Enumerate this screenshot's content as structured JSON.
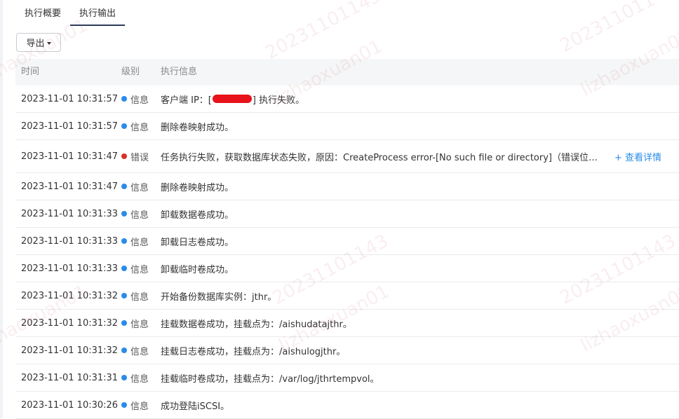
{
  "tabs": [
    {
      "label": "执行概要",
      "active": false
    },
    {
      "label": "执行输出",
      "active": true
    }
  ],
  "toolbar": {
    "export_label": "导出"
  },
  "table": {
    "headers": {
      "time": "时间",
      "level": "级别",
      "message": "执行信息"
    },
    "rows": [
      {
        "time": "2023-11-01 10:31:57",
        "level": "信息",
        "status": "info",
        "msg_before": "客户端 IP：[",
        "msg_after": "] 执行失败。"
      },
      {
        "time": "2023-11-01 10:31:57",
        "level": "信息",
        "status": "info",
        "message": "删除卷映射成功。"
      },
      {
        "time": "2023-11-01 10:31:47",
        "level": "错误",
        "status": "error",
        "message": "任务执行失败，获取数据库状态失败，原因：CreateProcess error-[No such file or directory]（错误位置：n…",
        "detail_link": "+ 查看详情"
      },
      {
        "time": "2023-11-01 10:31:47",
        "level": "信息",
        "status": "info",
        "message": "删除卷映射成功。"
      },
      {
        "time": "2023-11-01 10:31:33",
        "level": "信息",
        "status": "info",
        "message": "卸载数据卷成功。"
      },
      {
        "time": "2023-11-01 10:31:33",
        "level": "信息",
        "status": "info",
        "message": "卸载日志卷成功。"
      },
      {
        "time": "2023-11-01 10:31:33",
        "level": "信息",
        "status": "info",
        "message": "卸载临时卷成功。"
      },
      {
        "time": "2023-11-01 10:31:32",
        "level": "信息",
        "status": "info",
        "message": "开始备份数据库实例：jthr。"
      },
      {
        "time": "2023-11-01 10:31:32",
        "level": "信息",
        "status": "info",
        "message": "挂载数据卷成功，挂载点为：/aishudatajthr。"
      },
      {
        "time": "2023-11-01 10:31:32",
        "level": "信息",
        "status": "info",
        "message": "挂载日志卷成功，挂载点为：/aishulogjthr。"
      },
      {
        "time": "2023-11-01 10:31:31",
        "level": "信息",
        "status": "info",
        "message": "挂载临时卷成功，挂载点为：/var/log/jthrtempvol。"
      },
      {
        "time": "2023-11-01 10:30:26",
        "level": "信息",
        "status": "info",
        "message": "成功登陆iSCSI。"
      }
    ]
  },
  "watermark": {
    "id": "20231101143",
    "user": "lizhaoxuan01"
  },
  "colors": {
    "info": "#2a8be8",
    "error": "#d93026",
    "link": "#2a8be8",
    "redaction": "#e8121a"
  }
}
